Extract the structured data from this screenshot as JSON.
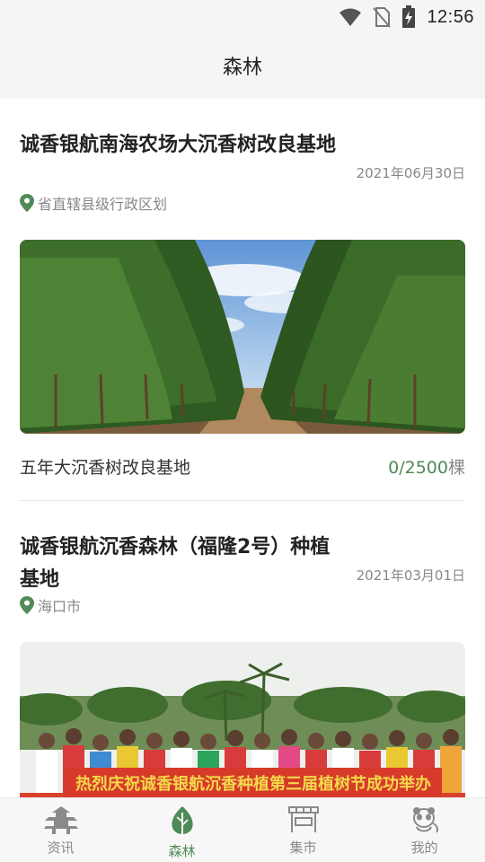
{
  "status_bar": {
    "time": "12:56",
    "icons": [
      "wifi-icon",
      "no-sim-icon",
      "battery-charging-icon"
    ]
  },
  "header": {
    "title": "森林"
  },
  "feed": {
    "items": [
      {
        "title": "诚香银航南海农场大沉香树改良基地",
        "date": "2021年06月30日",
        "location": "省直辖县级行政区划",
        "image": "forest-trees-photo",
        "subtitle": "五年大沉香树改良基地",
        "progress_count": "0/2500",
        "progress_unit": "棵"
      },
      {
        "title": "诚香银航沉香森林（福隆2号）种植基地",
        "date": "2021年03月01日",
        "location": "海口市",
        "image": "group-photo-with-banner",
        "banner_text": "热烈庆祝诚香银航沉香种植第三届植树节成功举办"
      }
    ]
  },
  "bottom_nav": {
    "items": [
      {
        "label": "资讯",
        "icon": "pagoda-icon",
        "active": false
      },
      {
        "label": "森林",
        "icon": "leaf-icon",
        "active": true
      },
      {
        "label": "集市",
        "icon": "market-stall-icon",
        "active": false
      },
      {
        "label": "我的",
        "icon": "panda-icon",
        "active": false
      }
    ]
  },
  "colors": {
    "accent": "#4f8a57",
    "header_bg": "#f5f5f5",
    "muted_text": "#888888"
  }
}
